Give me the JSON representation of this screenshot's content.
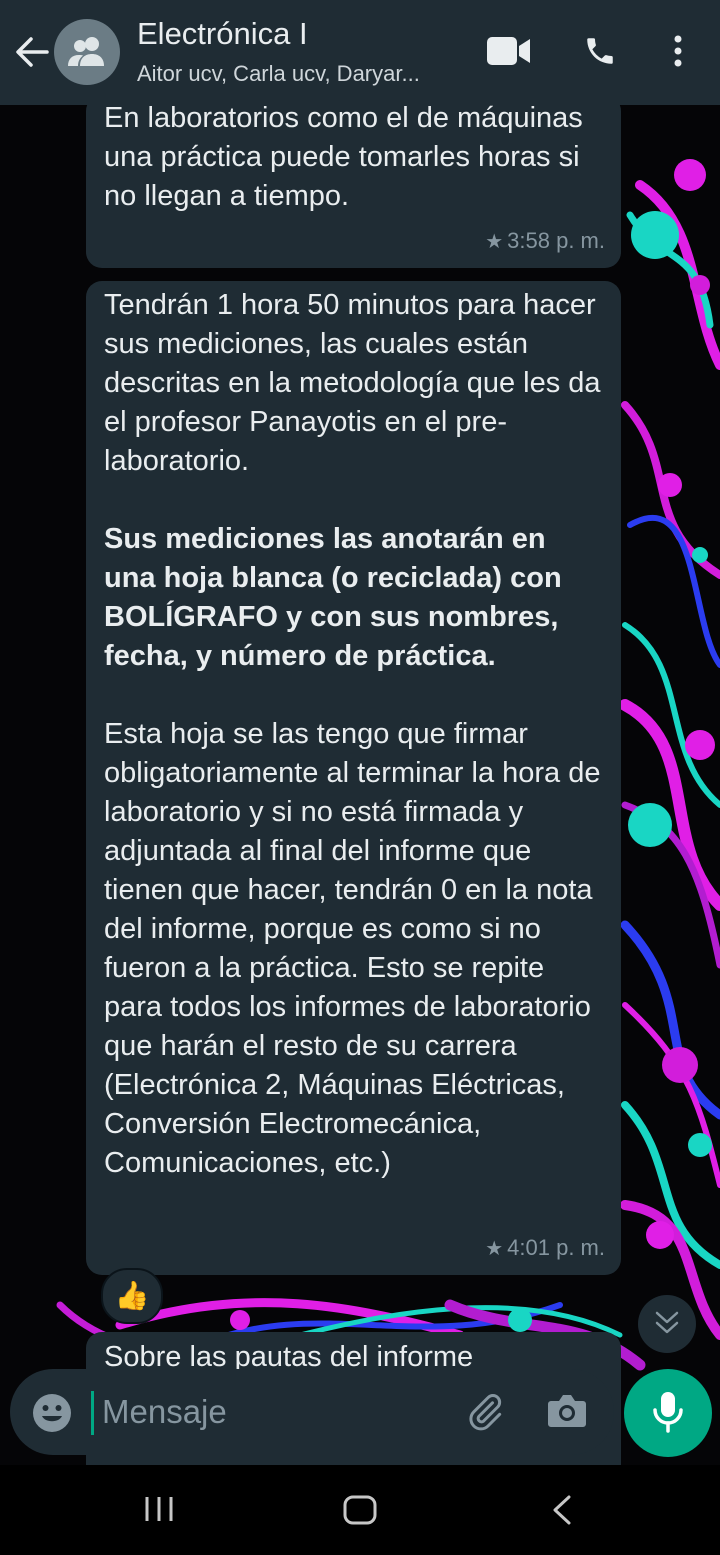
{
  "header": {
    "title": "Electrónica I",
    "subtitle": "Aitor ucv, Carla ucv, Daryar..."
  },
  "messages": [
    {
      "paragraphs": [
        {
          "text": "En laboratorios como el de máquinas una práctica puede tomarles horas si no llegan a tiempo.",
          "bold": false
        }
      ],
      "starred": true,
      "time": "3:58 p. m."
    },
    {
      "paragraphs": [
        {
          "text": "Tendrán 1 hora 50 minutos para hacer sus mediciones, las cuales están descritas en la metodología que les da el profesor Panayotis en el pre-laboratorio.",
          "bold": false
        },
        {
          "text": "Sus mediciones las anotarán en una hoja blanca (o reciclada) con BOLÍGRAFO y con sus nombres, fecha, y número de práctica.",
          "bold": true
        },
        {
          "text": "Esta hoja se las tengo que firmar obligatoriamente al terminar la hora de laboratorio y si no está firmada y adjuntada al final del informe que tienen que hacer, tendrán 0 en la nota del informe, porque es como si no fueron a la práctica. Esto se repite para todos los informes de laboratorio que harán el resto de su carrera (Electrónica 2, Máquinas Eléctricas, Conversión Electromecánica, Comunicaciones, etc.)",
          "bold": false
        }
      ],
      "starred": true,
      "time": "4:01 p. m.",
      "reaction": "👍"
    },
    {
      "paragraphs": [
        {
          "text": "Sobre las pautas del informe",
          "bold": false
        }
      ]
    }
  ],
  "composer": {
    "placeholder": "Mensaje"
  },
  "icons": {
    "back": "arrow-left-icon",
    "avatar": "group-avatar-icon",
    "video": "video-call-icon",
    "call": "phone-icon",
    "menu": "more-vertical-icon",
    "emoji": "emoji-icon",
    "attach": "paperclip-icon",
    "camera": "camera-icon",
    "mic": "microphone-icon",
    "scroll": "double-chevron-down-icon"
  },
  "colors": {
    "header_bg": "#1f2c34",
    "bubble_bg": "#1f2c34",
    "accent": "#00a884",
    "meta_text": "#8696a0"
  }
}
